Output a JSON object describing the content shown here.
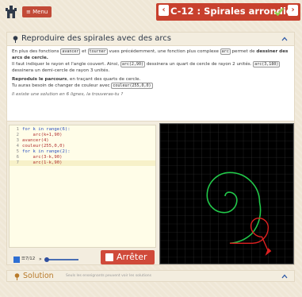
{
  "header": {
    "menu_label": "Menu",
    "title": "C-12 : Spirales arrondies",
    "prev_icon": "chevron-left-icon",
    "next_icon": "chevron-right-icon",
    "logo_icon": "castle-icon",
    "done_icon": "check-icon",
    "accent_color": "#c8402d"
  },
  "card": {
    "title": "Reproduire des spirales avec des arcs",
    "p1_a": "En plus des fonctions",
    "p1_kw1": "avancer",
    "p1_b": "et",
    "p1_kw2": "tourner",
    "p1_c": "vues précédemment, une fonction plus complexe",
    "p1_kw3": "arc",
    "p1_d": "permet de",
    "p1_bold": "dessiner des arcs de cercle.",
    "p2_a": "Il faut indiquer le rayon et l'angle couvert. Ainsi,",
    "p2_kw1": "arc(2,90)",
    "p2_b": "dessinera un quart de cercle de rayon 2 unités.",
    "p2_kw2": "arc(3,180)",
    "p2_c": "dessinera un demi-cercle de rayon 3 unités.",
    "p3_bold": "Reproduis le parcours",
    "p3_a": ", en traçant des quarts de cercle.",
    "p4_a": "Tu auras besoin de changer de couleur avec",
    "p4_kw": "couleur(255,0,0)",
    "p5": "Il existe une solution en 6 lignes, la trouveras-tu ?"
  },
  "editor": {
    "lines": [
      {
        "n": "1",
        "text": "for k in range(6):"
      },
      {
        "n": "2",
        "text": "    arc(k+1,90)"
      },
      {
        "n": "3",
        "text": "avancer(4)"
      },
      {
        "n": "4",
        "text": "couleur(255,0,0)"
      },
      {
        "n": "5",
        "text": "for k in range(2):"
      },
      {
        "n": "6",
        "text": "    arc(3-k,90)"
      },
      {
        "n": "7",
        "text": "    arc(1-k,90)"
      }
    ],
    "step": "7/12",
    "stop_label": "Arrêter"
  },
  "solution": {
    "title": "Solution",
    "note": "Seuls les enseignants peuvent voir les solutions"
  },
  "colors": {
    "path_green": "#22c94a",
    "path_red": "#e02020"
  }
}
